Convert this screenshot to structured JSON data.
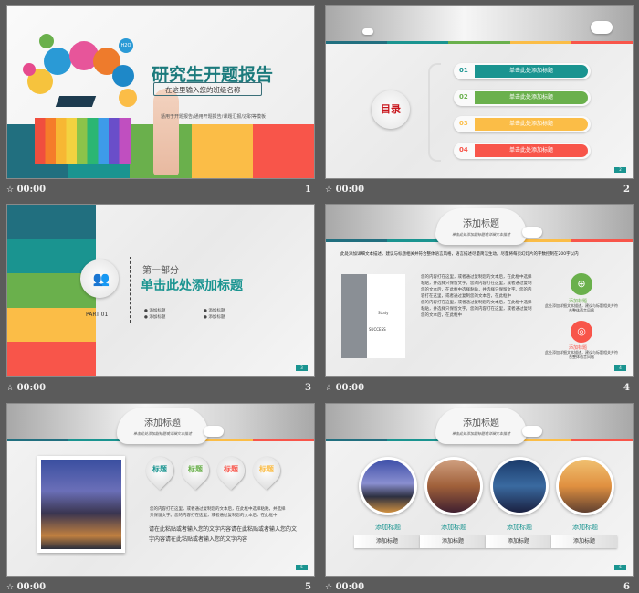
{
  "colors": {
    "teal_dark": "#216f7f",
    "teal": "#1a9490",
    "green": "#6ab04c",
    "yellow": "#fbbd47",
    "red": "#f8554a"
  },
  "slides": [
    {
      "number": "1",
      "time": "00:00",
      "title": "研究生开题报告",
      "input_placeholder": "在这里输入您的班级名称",
      "subtitle": "适用于开题报告/通用开题报告/课题汇报/述职等模板",
      "icon_text": "H2O"
    },
    {
      "number": "2",
      "time": "00:00",
      "toc_label": "目录",
      "items": [
        {
          "num": "01",
          "label": "单击此处添加标题"
        },
        {
          "num": "02",
          "label": "单击此处添加标题"
        },
        {
          "num": "03",
          "label": "单击此处添加标题"
        },
        {
          "num": "04",
          "label": "单击此处添加标题"
        }
      ],
      "page": "2"
    },
    {
      "number": "3",
      "time": "00:00",
      "part": "PART 01",
      "section": "第一部分",
      "title": "单击此处添加标题",
      "bullets": [
        "添加标题",
        "添加标题",
        "添加标题",
        "添加标题"
      ],
      "page": "3"
    },
    {
      "number": "4",
      "time": "00:00",
      "title": "添加标题",
      "subtitle": "单击此处添加副标题或详细文本描述",
      "intro": "此处添加详细文本描述，建议与标题相关并符合整体语言风格，语言描述尽量简洁生动。尽量将每页幻灯片的字数控制在200字以内",
      "body1": "您的内容打在这里，或者通过复制您的文本后，在此框中选择粘贴，并选择只保留文字。您的内容打在这里，或者通过复制您的文本后，在此框中选择粘贴，并选择只保留文字。您的内容打在这里，或者通过复制您的文本后，在此框中",
      "body2": "您的内容打在这里，或者通过复制您的文本后，在此框中选择粘贴，并选择只保留文字。您的内容打在这里，或者通过复制您的文本后，在此框中",
      "image_text": "Study",
      "image_text2": "SUCCESS",
      "feature1_title": "添加标题",
      "feature1_text": "此处添加详细文本描述，建议与标题相关并符合整体语言风格",
      "feature2_title": "添加标题",
      "feature2_text": "此处添加详细文本描述，建议与标题相关并符合整体语言风格",
      "page": "4"
    },
    {
      "number": "5",
      "time": "00:00",
      "title": "添加标题",
      "subtitle": "单击此处添加副标题或详细文本描述",
      "pins": [
        "标题",
        "标题",
        "标题",
        "标题"
      ],
      "body": "您的内容打在这里，或者通过复制您的文本后，在此框中选择粘贴，并选择只保留文字。您的内容打在这里，或者通过复制您的文本后，在此框中",
      "body_large": "请在此粘贴或者输入您的文字内容请在此粘贴或者输入您的文字内容请在此粘贴或者输入您的文字内容",
      "page": "5"
    },
    {
      "number": "6",
      "time": "00:00",
      "title": "添加标题",
      "subtitle": "单击此处添加副标题或详细文本描述",
      "cards": [
        {
          "title": "添加标题",
          "button": "添加标题"
        },
        {
          "title": "添加标题",
          "button": "添加标题"
        },
        {
          "title": "添加标题",
          "button": "添加标题"
        },
        {
          "title": "添加标题",
          "button": "添加标题"
        }
      ],
      "page": "6"
    }
  ]
}
